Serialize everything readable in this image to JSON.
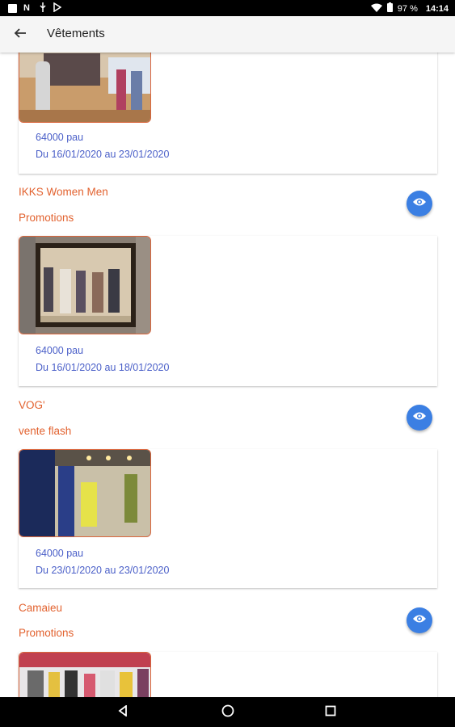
{
  "status_bar": {
    "battery": "97 %",
    "time": "14:14",
    "icons_left": [
      "notification-icon",
      "n-icon",
      "usb-icon",
      "play-icon"
    ],
    "icons_right": [
      "wifi-icon",
      "battery-icon"
    ]
  },
  "app_bar": {
    "title": "Vêtements",
    "back_icon": "arrow-back-icon"
  },
  "colors": {
    "accent": "#e2622f",
    "link": "#4a5fc8",
    "fab": "#3b7fe3"
  },
  "listings": [
    {
      "price": "64000 pau",
      "dates": "Du 16/01/2020 au 23/01/2020"
    },
    {
      "store": "IKKS Women Men",
      "type": "Promotions",
      "price": "64000 pau",
      "dates": "Du 16/01/2020 au 18/01/2020"
    },
    {
      "store": "VOG'",
      "type": "vente flash",
      "price": "64000 pau",
      "dates": "Du 23/01/2020 au 23/01/2020"
    },
    {
      "store": "Camaieu",
      "type": "Promotions"
    }
  ]
}
